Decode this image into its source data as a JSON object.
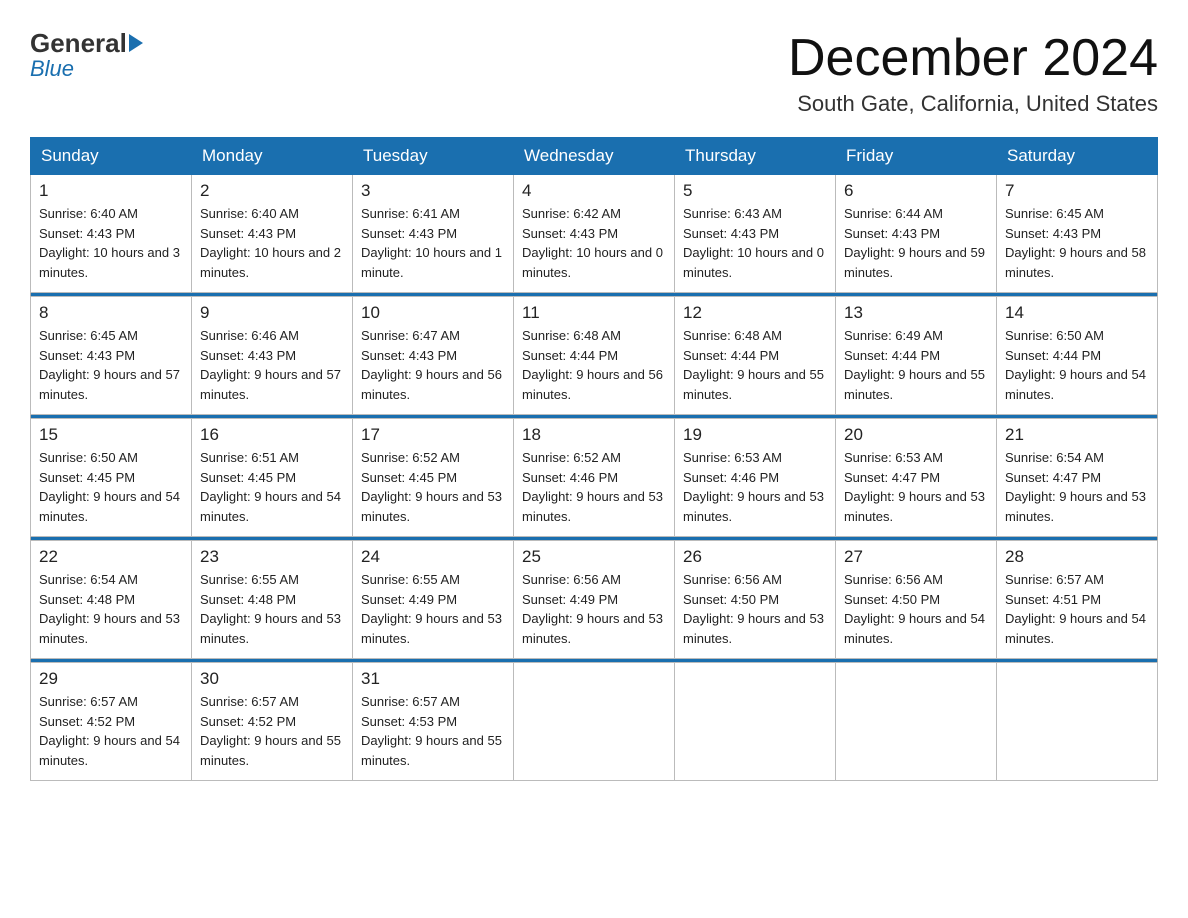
{
  "header": {
    "logo_general": "General",
    "logo_blue": "Blue",
    "month_title": "December 2024",
    "location": "South Gate, California, United States"
  },
  "days_of_week": [
    "Sunday",
    "Monday",
    "Tuesday",
    "Wednesday",
    "Thursday",
    "Friday",
    "Saturday"
  ],
  "weeks": [
    [
      {
        "num": "1",
        "sunrise": "6:40 AM",
        "sunset": "4:43 PM",
        "daylight": "10 hours and 3 minutes."
      },
      {
        "num": "2",
        "sunrise": "6:40 AM",
        "sunset": "4:43 PM",
        "daylight": "10 hours and 2 minutes."
      },
      {
        "num": "3",
        "sunrise": "6:41 AM",
        "sunset": "4:43 PM",
        "daylight": "10 hours and 1 minute."
      },
      {
        "num": "4",
        "sunrise": "6:42 AM",
        "sunset": "4:43 PM",
        "daylight": "10 hours and 0 minutes."
      },
      {
        "num": "5",
        "sunrise": "6:43 AM",
        "sunset": "4:43 PM",
        "daylight": "10 hours and 0 minutes."
      },
      {
        "num": "6",
        "sunrise": "6:44 AM",
        "sunset": "4:43 PM",
        "daylight": "9 hours and 59 minutes."
      },
      {
        "num": "7",
        "sunrise": "6:45 AM",
        "sunset": "4:43 PM",
        "daylight": "9 hours and 58 minutes."
      }
    ],
    [
      {
        "num": "8",
        "sunrise": "6:45 AM",
        "sunset": "4:43 PM",
        "daylight": "9 hours and 57 minutes."
      },
      {
        "num": "9",
        "sunrise": "6:46 AM",
        "sunset": "4:43 PM",
        "daylight": "9 hours and 57 minutes."
      },
      {
        "num": "10",
        "sunrise": "6:47 AM",
        "sunset": "4:43 PM",
        "daylight": "9 hours and 56 minutes."
      },
      {
        "num": "11",
        "sunrise": "6:48 AM",
        "sunset": "4:44 PM",
        "daylight": "9 hours and 56 minutes."
      },
      {
        "num": "12",
        "sunrise": "6:48 AM",
        "sunset": "4:44 PM",
        "daylight": "9 hours and 55 minutes."
      },
      {
        "num": "13",
        "sunrise": "6:49 AM",
        "sunset": "4:44 PM",
        "daylight": "9 hours and 55 minutes."
      },
      {
        "num": "14",
        "sunrise": "6:50 AM",
        "sunset": "4:44 PM",
        "daylight": "9 hours and 54 minutes."
      }
    ],
    [
      {
        "num": "15",
        "sunrise": "6:50 AM",
        "sunset": "4:45 PM",
        "daylight": "9 hours and 54 minutes."
      },
      {
        "num": "16",
        "sunrise": "6:51 AM",
        "sunset": "4:45 PM",
        "daylight": "9 hours and 54 minutes."
      },
      {
        "num": "17",
        "sunrise": "6:52 AM",
        "sunset": "4:45 PM",
        "daylight": "9 hours and 53 minutes."
      },
      {
        "num": "18",
        "sunrise": "6:52 AM",
        "sunset": "4:46 PM",
        "daylight": "9 hours and 53 minutes."
      },
      {
        "num": "19",
        "sunrise": "6:53 AM",
        "sunset": "4:46 PM",
        "daylight": "9 hours and 53 minutes."
      },
      {
        "num": "20",
        "sunrise": "6:53 AM",
        "sunset": "4:47 PM",
        "daylight": "9 hours and 53 minutes."
      },
      {
        "num": "21",
        "sunrise": "6:54 AM",
        "sunset": "4:47 PM",
        "daylight": "9 hours and 53 minutes."
      }
    ],
    [
      {
        "num": "22",
        "sunrise": "6:54 AM",
        "sunset": "4:48 PM",
        "daylight": "9 hours and 53 minutes."
      },
      {
        "num": "23",
        "sunrise": "6:55 AM",
        "sunset": "4:48 PM",
        "daylight": "9 hours and 53 minutes."
      },
      {
        "num": "24",
        "sunrise": "6:55 AM",
        "sunset": "4:49 PM",
        "daylight": "9 hours and 53 minutes."
      },
      {
        "num": "25",
        "sunrise": "6:56 AM",
        "sunset": "4:49 PM",
        "daylight": "9 hours and 53 minutes."
      },
      {
        "num": "26",
        "sunrise": "6:56 AM",
        "sunset": "4:50 PM",
        "daylight": "9 hours and 53 minutes."
      },
      {
        "num": "27",
        "sunrise": "6:56 AM",
        "sunset": "4:50 PM",
        "daylight": "9 hours and 54 minutes."
      },
      {
        "num": "28",
        "sunrise": "6:57 AM",
        "sunset": "4:51 PM",
        "daylight": "9 hours and 54 minutes."
      }
    ],
    [
      {
        "num": "29",
        "sunrise": "6:57 AM",
        "sunset": "4:52 PM",
        "daylight": "9 hours and 54 minutes."
      },
      {
        "num": "30",
        "sunrise": "6:57 AM",
        "sunset": "4:52 PM",
        "daylight": "9 hours and 55 minutes."
      },
      {
        "num": "31",
        "sunrise": "6:57 AM",
        "sunset": "4:53 PM",
        "daylight": "9 hours and 55 minutes."
      },
      null,
      null,
      null,
      null
    ]
  ]
}
